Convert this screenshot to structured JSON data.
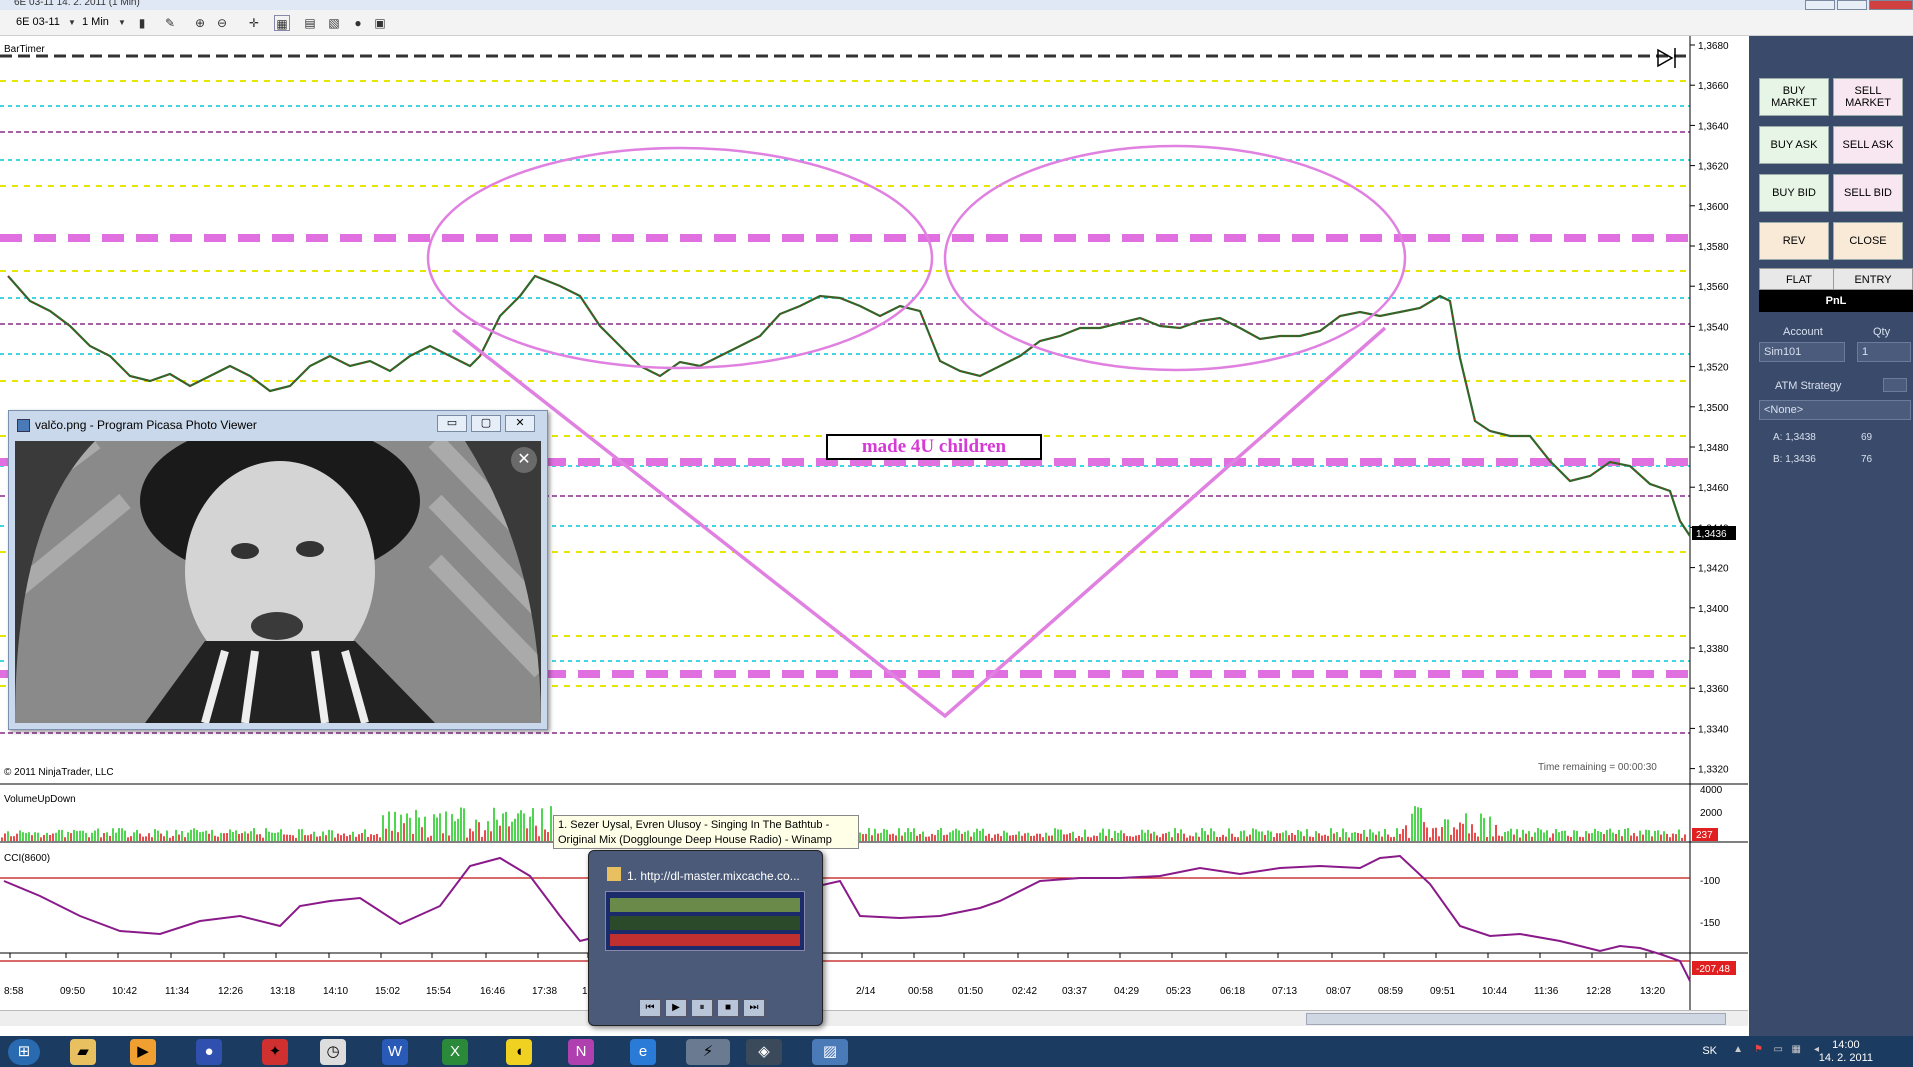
{
  "window": {
    "title": "6E 03-11  14. 2. 2011 (1 Min)"
  },
  "toolbar": {
    "instrument": "6E 03-11",
    "interval": "1 Min"
  },
  "chart": {
    "indicator_top": "BarTimer",
    "copyright": "© 2011 NinjaTrader, LLC",
    "time_remaining": "Time remaining = 00:00:30",
    "annotation": "made 4U children",
    "price_labels": [
      "1,3680",
      "1,3660",
      "1,3640",
      "1,3620",
      "1,3600",
      "1,3580",
      "1,3560",
      "1,3540",
      "1,3520",
      "1,3500",
      "1,3480",
      "1,3460",
      "1,3440",
      "1,3420",
      "1,3400",
      "1,3380",
      "1,3360",
      "1,3340",
      "1,3320"
    ],
    "last_price": "1,3436",
    "volume_label": "VolumeUpDown",
    "volume_axis": [
      "4000",
      "2000"
    ],
    "volume_last": "237",
    "cci_label": "CCI(8600)",
    "cci_axis": [
      "-100",
      "-150"
    ],
    "cci_last": "-207,48",
    "time_labels": [
      "8:58",
      "09:50",
      "10:42",
      "11:34",
      "12:26",
      "13:18",
      "14:10",
      "15:02",
      "15:54",
      "16:46",
      "17:38",
      "18:3",
      "2/14",
      "00:58",
      "01:50",
      "02:42",
      "03:37",
      "04:29",
      "05:23",
      "06:18",
      "07:13",
      "08:07",
      "08:59",
      "09:51",
      "10:44",
      "11:36",
      "12:28",
      "13:20"
    ]
  },
  "order_panel": {
    "buttons": [
      {
        "label": "BUY MARKET",
        "kind": "buy"
      },
      {
        "label": "SELL MARKET",
        "kind": "sell"
      },
      {
        "label": "BUY ASK",
        "kind": "buy"
      },
      {
        "label": "SELL ASK",
        "kind": "sell"
      },
      {
        "label": "BUY BID",
        "kind": "buy"
      },
      {
        "label": "SELL BID",
        "kind": "sell"
      },
      {
        "label": "REV",
        "kind": "rev"
      },
      {
        "label": "CLOSE",
        "kind": "rev"
      }
    ],
    "tab_flat": "FLAT",
    "tab_entry": "ENTRY",
    "pnl": "PnL",
    "account_label": "Account",
    "qty_label": "Qty",
    "account_value": "Sim101",
    "qty_value": "1",
    "atm_label": "ATM Strategy",
    "atm_value": "<None>",
    "ask_label": "A: 1,3438",
    "ask_size": "69",
    "bid_label": "B: 1,3436",
    "bid_size": "76"
  },
  "picasa": {
    "title": "valčo.png - Program Picasa Photo Viewer"
  },
  "winamp": {
    "tooltip": "1. Sezer Uysal, Evren Ulusoy - Singing In The Bathtub - Original Mix (Dogglounge Deep House Radio) - Winamp",
    "title": "1. http://dl-master.mixcache.co..."
  },
  "taskbar": {
    "language": "SK",
    "time": "14:00",
    "date": "14. 2. 2011"
  }
}
